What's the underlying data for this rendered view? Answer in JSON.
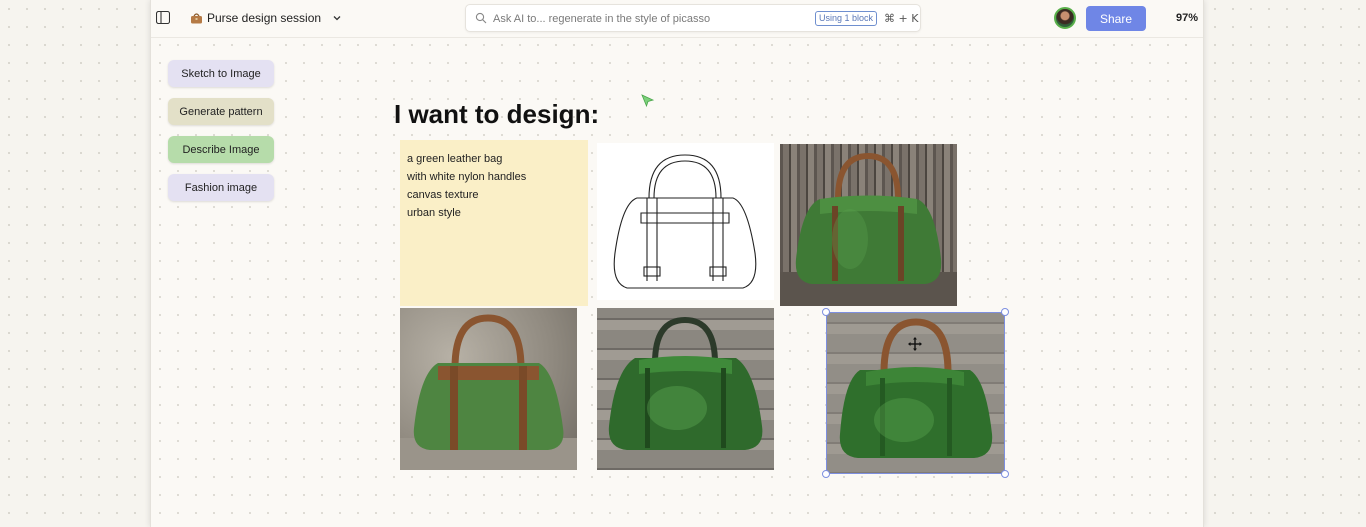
{
  "topbar": {
    "session_title": "Purse design session",
    "search_placeholder": "Ask AI to... regenerate in the style of picasso",
    "search_badge": "Using 1 block",
    "search_shortcut": "⌘ + K",
    "share_label": "Share",
    "zoom_level": "97%"
  },
  "toolbox": {
    "items": [
      {
        "label": "Sketch to Image"
      },
      {
        "label": "Generate pattern"
      },
      {
        "label": "Describe Image"
      },
      {
        "label": "Fashion image"
      }
    ]
  },
  "canvas": {
    "heading": "I want to design:",
    "note_lines": [
      "a green leather bag",
      "with white nylon handles",
      "canvas texture",
      "urban style"
    ]
  },
  "colors": {
    "accent": "#6f86e6",
    "note_bg": "#faefc7",
    "bag_green": "#3f7a36",
    "handle_brown": "#8a5530"
  }
}
